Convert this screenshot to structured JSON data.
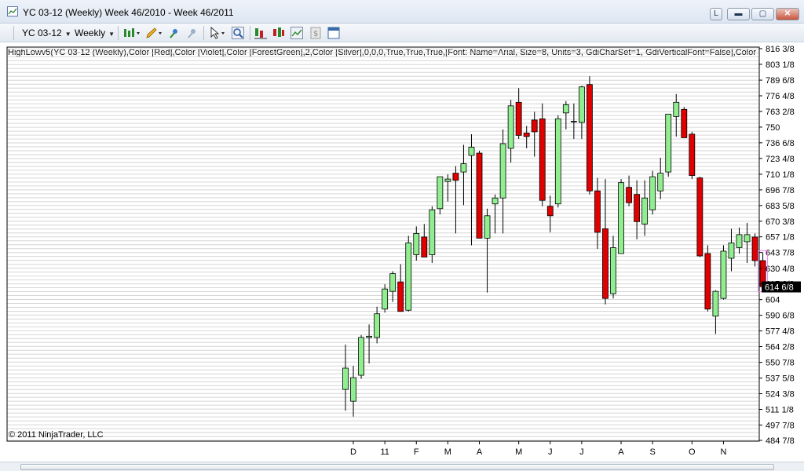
{
  "window": {
    "title": "YC 03-12 (Weekly)  Week 46/2010 - Week 46/2011",
    "btn_l": "L",
    "btn_min": "▬",
    "btn_max": "▢",
    "btn_close": "✕"
  },
  "toolbar": {
    "instrument": "YC 03-12",
    "period": "Weekly",
    "icons": [
      "bar-type-icon",
      "drawing-pencil-icon",
      "chart-marker-icon",
      "eraser-icon",
      "pointer-icon",
      "zoom-icon",
      "indicators-icon",
      "strategies-icon",
      "chart-properties-icon",
      "data-box-icon",
      "panel-icon"
    ]
  },
  "indicator_label": "HighLowv5(YC 03-12 (Weekly),Color [Red],Color [Violet],Color [ForestGreen],2,Color [Silver],0,0,0,True,True,True,[Font: Name=Arial, Size=8, Units=3, GdiCharSet=1, GdiVerticalFont=False],Color",
  "copyright": "© 2011 NinjaTrader, LLC",
  "colors": {
    "up_fill": "#90ee90",
    "down_fill": "#e00000",
    "wick": "#000000",
    "grid": "#d6d6d6",
    "last_price_box": "#000000",
    "highlight": "#ee82ee"
  },
  "chart_data": {
    "type": "candlestick",
    "y_tick_labels": [
      "816 3/8",
      "803 1/8",
      "789 6/8",
      "776 4/8",
      "763 2/8",
      "750",
      "736 6/8",
      "723 4/8",
      "710 1/8",
      "696 7/8",
      "683 5/8",
      "670 3/8",
      "657 1/8",
      "643 7/8",
      "630 4/8",
      "617 2/8",
      "604",
      "590 6/8",
      "577 4/8",
      "564 2/8",
      "550 7/8",
      "537 5/8",
      "524 3/8",
      "511 1/8",
      "497 7/8",
      "484 7/8"
    ],
    "y_tick_values": [
      816.375,
      803.125,
      789.75,
      776.5,
      763.25,
      750,
      736.75,
      723.5,
      710.125,
      696.875,
      683.625,
      670.375,
      657.125,
      643.875,
      630.5,
      617.25,
      604,
      590.75,
      577.5,
      564.25,
      550.875,
      537.625,
      524.375,
      511.125,
      497.875,
      484.875
    ],
    "ylim": [
      484.875,
      816.375
    ],
    "x_labels": [
      {
        "label": "D",
        "index": 1
      },
      {
        "label": "11",
        "index": 5
      },
      {
        "label": "F",
        "index": 9
      },
      {
        "label": "M",
        "index": 13
      },
      {
        "label": "A",
        "index": 17
      },
      {
        "label": "M",
        "index": 22
      },
      {
        "label": "J",
        "index": 26
      },
      {
        "label": "J",
        "index": 30
      },
      {
        "label": "A",
        "index": 35
      },
      {
        "label": "S",
        "index": 39
      },
      {
        "label": "O",
        "index": 44
      },
      {
        "label": "N",
        "index": 48
      }
    ],
    "last_price_label": "614 6/8",
    "last_price": 614.75,
    "bars": [
      {
        "o": 528,
        "h": 566,
        "l": 510,
        "c": 546
      },
      {
        "o": 518,
        "h": 548,
        "l": 505,
        "c": 538
      },
      {
        "o": 540,
        "h": 574,
        "l": 537,
        "c": 572
      },
      {
        "o": 572,
        "h": 583,
        "l": 550,
        "c": 573
      },
      {
        "o": 572,
        "h": 598,
        "l": 567,
        "c": 592
      },
      {
        "o": 596,
        "h": 617,
        "l": 593,
        "c": 613
      },
      {
        "o": 611,
        "h": 628,
        "l": 602,
        "c": 626
      },
      {
        "o": 619,
        "h": 634,
        "l": 600,
        "c": 594
      },
      {
        "o": 595,
        "h": 658,
        "l": 594,
        "c": 652
      },
      {
        "o": 642,
        "h": 666,
        "l": 637,
        "c": 660
      },
      {
        "o": 657,
        "h": 668,
        "l": 640,
        "c": 640
      },
      {
        "o": 642,
        "h": 683,
        "l": 635,
        "c": 680
      },
      {
        "o": 681,
        "h": 706,
        "l": 676,
        "c": 708
      },
      {
        "o": 704,
        "h": 710,
        "l": 687,
        "c": 706
      },
      {
        "o": 711,
        "h": 717,
        "l": 660,
        "c": 705
      },
      {
        "o": 712,
        "h": 735,
        "l": 684,
        "c": 719
      },
      {
        "o": 726,
        "h": 744,
        "l": 650,
        "c": 733
      },
      {
        "o": 728,
        "h": 730,
        "l": 660,
        "c": 656
      },
      {
        "o": 656,
        "h": 681,
        "l": 610,
        "c": 675
      },
      {
        "o": 685,
        "h": 693,
        "l": 660,
        "c": 690
      },
      {
        "o": 690,
        "h": 748,
        "l": 660,
        "c": 736
      },
      {
        "o": 732,
        "h": 773,
        "l": 720,
        "c": 768
      },
      {
        "o": 771,
        "h": 783,
        "l": 740,
        "c": 743
      },
      {
        "o": 745,
        "h": 751,
        "l": 732,
        "c": 742
      },
      {
        "o": 756,
        "h": 763,
        "l": 725,
        "c": 746
      },
      {
        "o": 757,
        "h": 770,
        "l": 683,
        "c": 688
      },
      {
        "o": 683,
        "h": 692,
        "l": 661,
        "c": 675
      },
      {
        "o": 685,
        "h": 760,
        "l": 682,
        "c": 757
      },
      {
        "o": 762,
        "h": 772,
        "l": 748,
        "c": 769
      },
      {
        "o": 755,
        "h": 770,
        "l": 740,
        "c": 755
      },
      {
        "o": 754,
        "h": 785,
        "l": 740,
        "c": 784
      },
      {
        "o": 786,
        "h": 793,
        "l": 693,
        "c": 696
      },
      {
        "o": 696,
        "h": 707,
        "l": 647,
        "c": 661
      },
      {
        "o": 664,
        "h": 706,
        "l": 600,
        "c": 605
      },
      {
        "o": 609,
        "h": 658,
        "l": 605,
        "c": 648
      },
      {
        "o": 643,
        "h": 706,
        "l": 648,
        "c": 703
      },
      {
        "o": 699,
        "h": 709,
        "l": 683,
        "c": 686
      },
      {
        "o": 693,
        "h": 705,
        "l": 655,
        "c": 670
      },
      {
        "o": 668,
        "h": 705,
        "l": 658,
        "c": 690
      },
      {
        "o": 680,
        "h": 713,
        "l": 676,
        "c": 708
      },
      {
        "o": 696,
        "h": 724,
        "l": 689,
        "c": 711
      },
      {
        "o": 712,
        "h": 760,
        "l": 708,
        "c": 761
      },
      {
        "o": 759,
        "h": 778,
        "l": 742,
        "c": 771
      },
      {
        "o": 765,
        "h": 767,
        "l": 742,
        "c": 741
      },
      {
        "o": 744,
        "h": 746,
        "l": 706,
        "c": 709
      },
      {
        "o": 707,
        "h": 708,
        "l": 640,
        "c": 641
      },
      {
        "o": 643,
        "h": 650,
        "l": 594,
        "c": 596
      },
      {
        "o": 590,
        "h": 612,
        "l": 575,
        "c": 611
      },
      {
        "o": 605,
        "h": 650,
        "l": 604,
        "c": 645
      },
      {
        "o": 639,
        "h": 664,
        "l": 628,
        "c": 652
      },
      {
        "o": 648,
        "h": 665,
        "l": 643,
        "c": 659
      },
      {
        "o": 653,
        "h": 669,
        "l": 635,
        "c": 659
      },
      {
        "o": 657,
        "h": 660,
        "l": 632,
        "c": 637
      },
      {
        "o": 637,
        "h": 644,
        "l": 612,
        "c": 615
      }
    ]
  }
}
